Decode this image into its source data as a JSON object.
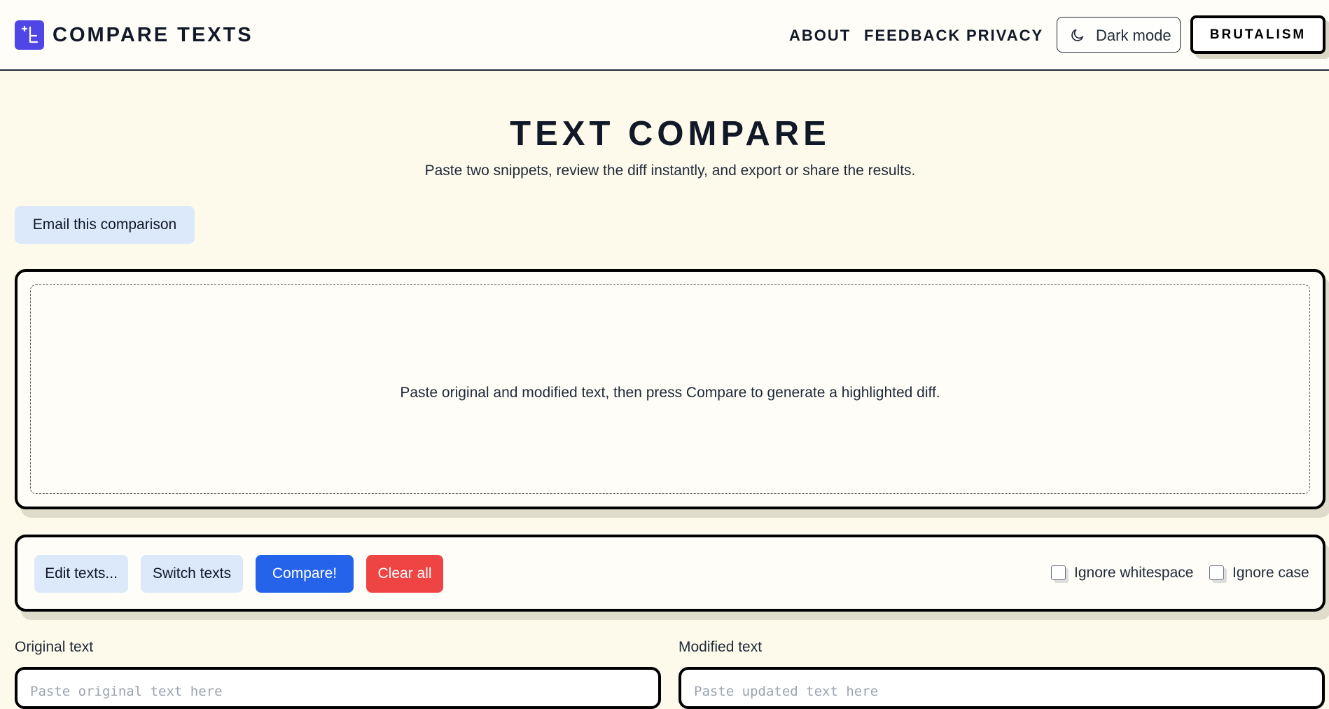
{
  "header": {
    "brand": "COMPARE TEXTS",
    "logo_icon": "compare-logo-icon",
    "nav": [
      "ABOUT",
      "FEEDBACK",
      "PRIVACY"
    ],
    "dark_mode_label": "Dark mode",
    "dark_mode_icon": "moon-icon",
    "brutalism_label": "BRUTALISM"
  },
  "hero": {
    "title": "TEXT COMPARE",
    "subtitle": "Paste two snippets, review the diff instantly, and export or share the results."
  },
  "email_button": "Email this comparison",
  "diff": {
    "empty_message": "Paste original and modified text, then press Compare to generate a highlighted diff."
  },
  "controls": {
    "edit_label": "Edit texts...",
    "switch_label": "Switch texts",
    "compare_label": "Compare!",
    "clear_label": "Clear all",
    "ignore_whitespace_label": "Ignore whitespace",
    "ignore_case_label": "Ignore case"
  },
  "original": {
    "label": "Original text",
    "placeholder": "Paste original text here"
  },
  "modified": {
    "label": "Modified text",
    "placeholder": "Paste updated text here"
  },
  "colors": {
    "background": "#fdfaec",
    "accent_purple": "#4f46e5",
    "compare_blue": "#2563eb",
    "clear_red": "#ef4444",
    "light_button": "#dbe9fb"
  }
}
